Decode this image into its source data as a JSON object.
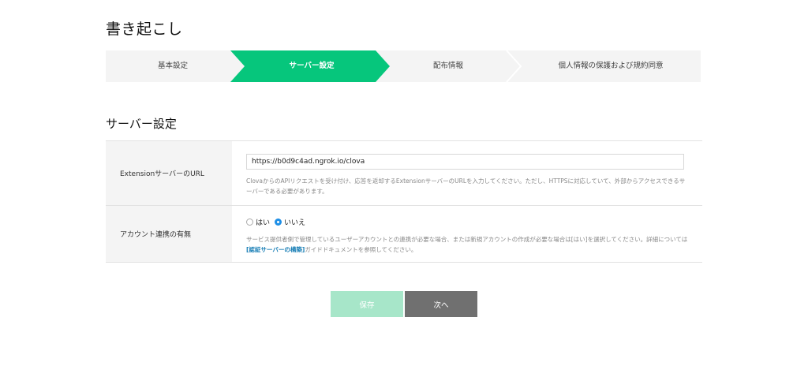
{
  "page": {
    "title": "書き起こし"
  },
  "stepper": {
    "steps": [
      {
        "label": "基本設定",
        "active": false
      },
      {
        "label": "サーバー設定",
        "active": true
      },
      {
        "label": "配布情報",
        "active": false
      },
      {
        "label": "個人情報の保護および規約同意",
        "active": false
      }
    ],
    "colors": {
      "active": "#06c67c",
      "inactive": "#f4f4f4",
      "divider": "#ffffff"
    }
  },
  "section": {
    "title": "サーバー設定"
  },
  "form": {
    "url_row": {
      "label": "ExtensionサーバーのURL",
      "value": "https://b0d9c4ad.ngrok.io/clova",
      "help": "ClovaからのAPIリクエストを受け付け、応答を返却するExtensionサーバーのURLを入力してください。ただし、HTTPSに対応していて、外部からアクセスできるサーバーである必要があります。"
    },
    "account_row": {
      "label": "アカウント連携の有無",
      "options": [
        {
          "label": "はい",
          "checked": false
        },
        {
          "label": "いいえ",
          "checked": true
        }
      ],
      "help_before": "サービス提供者側で管理しているユーザーアカウントとの連携が必要な場合、または新規アカウントの作成が必要な場合は[はい]を選択してください。詳細については",
      "help_link": "[認証サーバーの構築]",
      "help_after": "ガイドドキュメントを参照してください。"
    }
  },
  "buttons": {
    "save": "保存",
    "next": "次へ"
  }
}
